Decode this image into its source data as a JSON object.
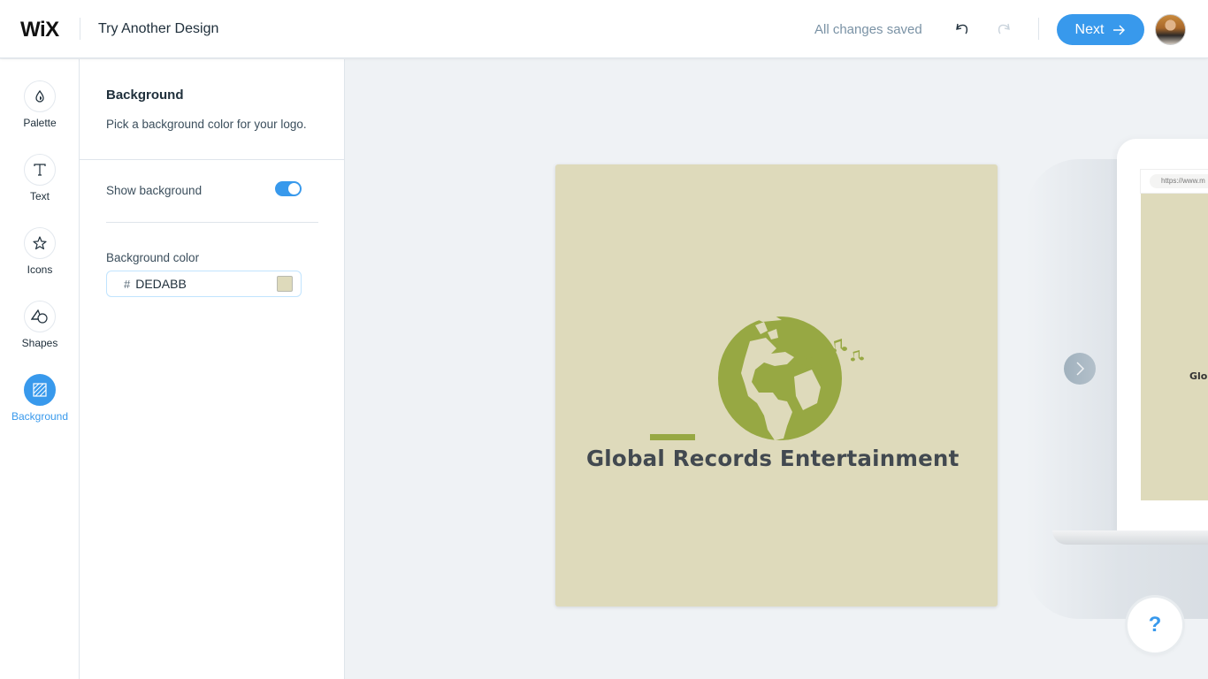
{
  "header": {
    "brand": "WiX",
    "design_link": "Try Another Design",
    "save_status": "All changes saved",
    "undo_icon": "undo-icon",
    "redo_icon": "redo-icon",
    "next_label": "Next",
    "next_icon": "arrow-right-icon",
    "avatar_alt": "user-avatar"
  },
  "nav": {
    "items": [
      {
        "label": "Palette",
        "icon": "palette-drop-icon"
      },
      {
        "label": "Text",
        "icon": "text-t-icon"
      },
      {
        "label": "Icons",
        "icon": "star-icon"
      },
      {
        "label": "Shapes",
        "icon": "shapes-icon"
      },
      {
        "label": "Background",
        "icon": "background-hatch-icon",
        "active": true
      }
    ]
  },
  "panel": {
    "title": "Background",
    "description": "Pick a background color for your logo.",
    "show_background_label": "Show background",
    "show_background": true,
    "color_label": "Background color",
    "hash": "#",
    "color_value": "DEDABB"
  },
  "canvas": {
    "logo_text": "Global Records Entertainment",
    "logo_bg": "#dedabb",
    "accent": "#97a843",
    "text_color": "#424950",
    "preview_url": "https://www.m",
    "preview_text": "Glo"
  },
  "help": {
    "label": "?"
  },
  "colors": {
    "primary": "#3899ec",
    "muted": "#7a92a5"
  }
}
